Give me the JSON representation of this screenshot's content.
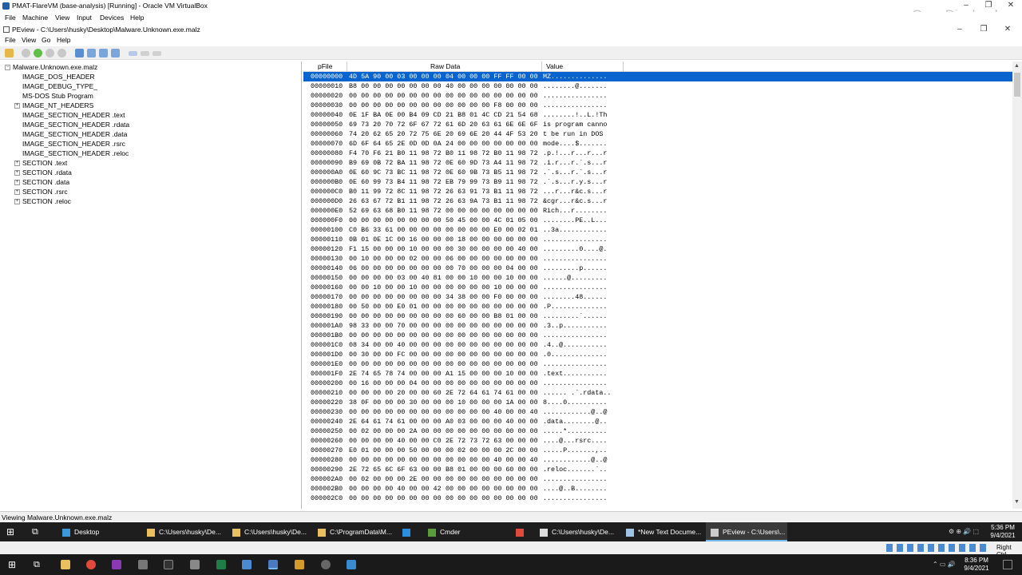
{
  "host": {
    "title": "PMAT-FlareVM (base-analysis) [Running] - Oracle VM VirtualBox",
    "menu": [
      "File",
      "Machine",
      "View",
      "Input",
      "Devices",
      "Help"
    ],
    "watermark": "OpenDir.cloud",
    "clock": {
      "time": "8:36 PM",
      "date": "9/4/2021"
    },
    "status_right": "Right Ctrl"
  },
  "peview": {
    "title": "PEview - C:\\Users\\husky\\Desktop\\Malware.Unknown.exe.malz",
    "menu": [
      "File",
      "View",
      "Go",
      "Help"
    ],
    "tree": [
      {
        "label": "Malware.Unknown.exe.malz",
        "level": 0,
        "expander": "−"
      },
      {
        "label": "IMAGE_DOS_HEADER",
        "level": 1,
        "expander": ""
      },
      {
        "label": "IMAGE_DEBUG_TYPE_",
        "level": 1,
        "expander": ""
      },
      {
        "label": "MS-DOS Stub Program",
        "level": 1,
        "expander": ""
      },
      {
        "label": "IMAGE_NT_HEADERS",
        "level": 1,
        "expander": "+"
      },
      {
        "label": "IMAGE_SECTION_HEADER .text",
        "level": 1,
        "expander": ""
      },
      {
        "label": "IMAGE_SECTION_HEADER .rdata",
        "level": 1,
        "expander": ""
      },
      {
        "label": "IMAGE_SECTION_HEADER .data",
        "level": 1,
        "expander": ""
      },
      {
        "label": "IMAGE_SECTION_HEADER .rsrc",
        "level": 1,
        "expander": ""
      },
      {
        "label": "IMAGE_SECTION_HEADER .reloc",
        "level": 1,
        "expander": ""
      },
      {
        "label": "SECTION .text",
        "level": 1,
        "expander": "+"
      },
      {
        "label": "SECTION .rdata",
        "level": 1,
        "expander": "+"
      },
      {
        "label": "SECTION .data",
        "level": 1,
        "expander": "+"
      },
      {
        "label": "SECTION .rsrc",
        "level": 1,
        "expander": "+"
      },
      {
        "label": "SECTION .reloc",
        "level": 1,
        "expander": "+"
      }
    ],
    "columns": {
      "pfile": "pFile",
      "raw": "Raw Data",
      "value": "Value"
    },
    "rows": [
      [
        "00000000",
        "4D 5A 90 00 03 00 00 00",
        "04 00 00 00 FF FF 00 00",
        "MZ.............."
      ],
      [
        "00000010",
        "B8 00 00 00 00 00 00 00",
        "40 00 00 00 00 00 00 00",
        "........@......."
      ],
      [
        "00000020",
        "00 00 00 00 00 00 00 00",
        "00 00 00 00 00 00 00 00",
        "................"
      ],
      [
        "00000030",
        "00 00 00 00 00 00 00 00",
        "00 00 00 00 F8 00 00 00",
        "................"
      ],
      [
        "00000040",
        "0E 1F BA 0E 00 B4 09 CD",
        "21 B8 01 4C CD 21 54 68",
        "........!..L.!Th"
      ],
      [
        "00000050",
        "69 73 20 70 72 6F 67 72",
        "61 6D 20 63 61 6E 6E 6F",
        "is program canno"
      ],
      [
        "00000060",
        "74 20 62 65 20 72 75 6E",
        "20 69 6E 20 44 4F 53 20",
        "t be run in DOS "
      ],
      [
        "00000070",
        "6D 6F 64 65 2E 0D 0D 0A",
        "24 00 00 00 00 00 00 00",
        "mode....$......."
      ],
      [
        "00000080",
        "F4 70 F6 21 B0 11 98 72",
        "B0 11 98 72 B0 11 98 72",
        ".p.!...r...r...r"
      ],
      [
        "00000090",
        "B9 69 0B 72 BA 11 98 72",
        "0E 60 9D 73 A4 11 98 72",
        ".i.r...r.`.s...r"
      ],
      [
        "000000A0",
        "0E 60 9C 73 BC 11 98 72",
        "0E 60 9B 73 B5 11 98 72",
        ".`.s...r.`.s...r"
      ],
      [
        "000000B0",
        "0E 60 99 73 B4 11 98 72",
        "EB 79 99 73 B9 11 98 72",
        ".`.s...r.y.s...r"
      ],
      [
        "000000C0",
        "B0 11 99 72 8C 11 98 72",
        "26 63 91 73 B1 11 98 72",
        "...r...r&c.s...r"
      ],
      [
        "000000D0",
        "26 63 67 72 B1 11 98 72",
        "26 63 9A 73 B1 11 98 72",
        "&cgr...r&c.s...r"
      ],
      [
        "000000E0",
        "52 69 63 68 B0 11 98 72",
        "00 00 00 00 00 00 00 00",
        "Rich...r........"
      ],
      [
        "000000F0",
        "00 00 00 00 00 00 00 00",
        "50 45 00 00 4C 01 05 00",
        "........PE..L..."
      ],
      [
        "00000100",
        "C0 B6 33 61 00 00 00 00",
        "00 00 00 00 E0 00 02 01",
        "..3a............"
      ],
      [
        "00000110",
        "0B 01 0E 1C 00 16 00 00",
        "00 18 00 00 00 00 00 00",
        "................"
      ],
      [
        "00000120",
        "F1 15 00 00 00 10 00 00",
        "00 30 00 00 00 00 40 00",
        ".........0....@."
      ],
      [
        "00000130",
        "00 10 00 00 00 02 00 00",
        "06 00 00 00 00 00 00 00",
        "................"
      ],
      [
        "00000140",
        "06 00 00 00 00 00 00 00",
        "00 70 00 00 00 04 00 00",
        ".........p......"
      ],
      [
        "00000150",
        "00 00 00 00 03 00 40 81",
        "00 00 10 00 00 10 00 00",
        "......@........."
      ],
      [
        "00000160",
        "00 00 10 00 00 10 00 00",
        "00 00 00 00 10 00 00 00",
        "................"
      ],
      [
        "00000170",
        "00 00 00 00 00 00 00 00",
        "34 38 00 00 F0 00 00 00",
        "........48......"
      ],
      [
        "00000180",
        "00 50 00 00 E0 01 00 00",
        "00 00 00 00 00 00 00 00",
        ".P.............."
      ],
      [
        "00000190",
        "00 00 00 00 00 00 00 00",
        "00 60 00 00 B8 01 00 00",
        ".........`......"
      ],
      [
        "000001A0",
        "98 33 00 00 70 00 00 00",
        "00 00 00 00 00 00 00 00",
        ".3..p..........."
      ],
      [
        "000001B0",
        "00 00 00 00 00 00 00 00",
        "00 00 00 00 00 00 00 00",
        "................"
      ],
      [
        "000001C0",
        "08 34 00 00 40 00 00 00",
        "00 00 00 00 00 00 00 00",
        ".4..@..........."
      ],
      [
        "000001D0",
        "00 30 00 00 FC 00 00 00",
        "00 00 00 00 00 00 00 00",
        ".0.............."
      ],
      [
        "000001E0",
        "00 00 00 00 00 00 00 00",
        "00 00 00 00 00 00 00 00",
        "................"
      ],
      [
        "000001F0",
        "2E 74 65 78 74 00 00 00",
        "A1 15 00 00 00 10 00 00",
        ".text..........."
      ],
      [
        "00000200",
        "00 16 00 00 00 04 00 00",
        "00 00 00 00 00 00 00 00",
        "................"
      ],
      [
        "00000210",
        "00 00 00 00 20 00 00 60",
        "2E 72 64 61 74 61 00 00",
        "...... .`.rdata.."
      ],
      [
        "00000220",
        "38 0F 00 00 00 30 00 00",
        "00 10 00 00 00 1A 00 00",
        "8....0.........."
      ],
      [
        "00000230",
        "00 00 00 00 00 00 00 00",
        "00 00 00 00 40 00 00 40",
        "............@..@"
      ],
      [
        "00000240",
        "2E 64 61 74 61 00 00 00",
        "A0 03 00 00 00 40 00 00",
        ".data........@.."
      ],
      [
        "00000250",
        "00 02 00 00 00 2A 00 00",
        "00 00 00 00 00 00 00 00",
        ".....*.........."
      ],
      [
        "00000260",
        "00 00 00 00 40 00 00 C0",
        "2E 72 73 72 63 00 00 00",
        "....@...rsrc...."
      ],
      [
        "00000270",
        "E0 01 00 00 00 50 00 00",
        "00 02 00 00 00 2C 00 00",
        ".....P.......,.."
      ],
      [
        "00000280",
        "00 00 00 00 00 00 00 00",
        "00 00 00 00 40 00 00 40",
        "............@..@"
      ],
      [
        "00000290",
        "2E 72 65 6C 6F 63 00 00",
        "B8 01 00 00 00 60 00 00",
        ".reloc.......`.."
      ],
      [
        "000002A0",
        "00 02 00 00 00 2E 00 00",
        "00 00 00 00 00 00 00 00",
        "................"
      ],
      [
        "000002B0",
        "00 00 00 00 40 00 00 42",
        "00 00 00 00 00 00 00 00",
        "....@..B........"
      ],
      [
        "000002C0",
        "00 00 00 00 00 00 00 00",
        "00 00 00 00 00 00 00 00",
        "................"
      ]
    ],
    "status": "Viewing Malware.Unknown.exe.malz"
  },
  "guest_taskbar": {
    "items": [
      {
        "label": "Desktop",
        "icon": "desktop-icon",
        "color": "#3a9ad9"
      },
      {
        "label": "C:\\Users\\husky\\De...",
        "icon": "folder-icon",
        "color": "#e8c060"
      },
      {
        "label": "C:\\Users\\husky\\De...",
        "icon": "folder-icon",
        "color": "#e8c060"
      },
      {
        "label": "C:\\ProgramData\\M...",
        "icon": "folder-icon",
        "color": "#e8c060"
      },
      {
        "label": "",
        "icon": "vscode-icon",
        "color": "#2b8fe0"
      },
      {
        "label": "Cmder",
        "icon": "cmder-icon",
        "color": "#5a9b3c"
      },
      {
        "label": "",
        "icon": "chrome-icon",
        "color": "#e04a3a"
      },
      {
        "label": "C:\\Users\\husky\\De...",
        "icon": "terminal-icon",
        "color": "#dddddd"
      },
      {
        "label": "*New Text Docume...",
        "icon": "notepad-icon",
        "color": "#9fc4e8"
      },
      {
        "label": "PEview - C:\\Users\\...",
        "icon": "peview-icon",
        "color": "#cccccc"
      }
    ],
    "clock": {
      "time": "5:36 PM",
      "date": "9/4/2021"
    }
  }
}
